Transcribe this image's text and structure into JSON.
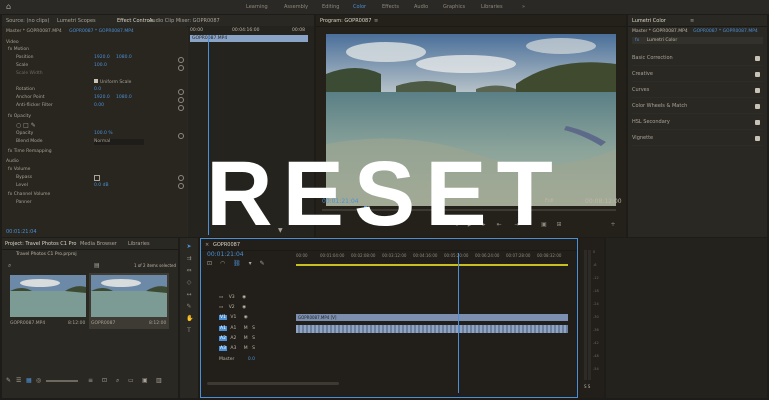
{
  "workspaces": [
    "Learning",
    "Assembly",
    "Editing",
    "Color",
    "Effects",
    "Audio",
    "Graphics",
    "Libraries"
  ],
  "active_workspace": "Color",
  "left_top_tabs": [
    "Source: (no clips)",
    "Lumetri Scopes",
    "Effect Controls",
    "Audio Clip Mixer: GOPR0087"
  ],
  "effect_controls": {
    "source": "Master * GOPR0087.MP4",
    "sequence": "GOPR0087 * GOPR0087.MP4",
    "header": "Video",
    "motion": "Motion",
    "position_label": "Position",
    "position_x": "1920.0",
    "position_y": "1080.0",
    "scale_label": "Scale",
    "scale_val": "100.0",
    "scale_width_label": "Scale Width",
    "uniform_scale": "Uniform Scale",
    "rotation_label": "Rotation",
    "rotation_val": "0.0",
    "anchor_label": "Anchor Point",
    "anchor_x": "1920.0",
    "anchor_y": "1080.0",
    "antiflicker_label": "Anti-flicker Filter",
    "antiflicker_val": "0.00",
    "opacity_section": "Opacity",
    "opacity_label": "Opacity",
    "opacity_val": "100.0 %",
    "blend_label": "Blend Mode",
    "blend_val": "Normal",
    "time_remap": "Time Remapping",
    "audio_header": "Audio",
    "volume": "Volume",
    "bypass_label": "Bypass",
    "level_label": "Level",
    "level_val": "0.0 dB",
    "channel_volume": "Channel Volume",
    "panner": "Panner",
    "clip_name": "GOPR0087.MP4",
    "timecode_top1": "00:00",
    "timecode_top2": "00:04:16:00",
    "timecode_top3": "00:08",
    "timecode_bottom": "00:01:21:04"
  },
  "program": {
    "title": "Program: GOPR0087",
    "timecode": "00:01:21:04",
    "fit": "Full",
    "duration": "00:08:12:00"
  },
  "lumetri": {
    "title": "Lumetri Color",
    "source": "Master * GOPR0087.MP4",
    "sequence": "GOPR0087 * GOPR0087.MP4",
    "fx": "fx",
    "effect_name": "Lumetri Color",
    "sections": [
      "Basic Correction",
      "Creative",
      "Curves",
      "Color Wheels & Match",
      "HSL Secondary",
      "Vignette"
    ]
  },
  "project": {
    "tabs": [
      "Project: Travel Photos C1 Pro",
      "Media Browser",
      "Libraries"
    ],
    "file": "Travel Photos C1 Pro.prproj",
    "selection": "1 of 2 items selected",
    "items": [
      {
        "name": "GOPR0087.MP4",
        "duration": "8:12:00"
      },
      {
        "name": "GOPR0087",
        "duration": "8:12:00"
      }
    ]
  },
  "timeline": {
    "close": "×",
    "sequence_name": "GOPR0087",
    "timecode": "00:01:21:04",
    "ruler": [
      "00:00",
      "00:01:04:00",
      "00:02:08:00",
      "00:03:12:00",
      "00:04:16:00",
      "00:05:20:00",
      "00:06:24:00",
      "00:07:28:00",
      "00:08:32:00"
    ],
    "tracks_v": [
      "V3",
      "V2",
      "V1"
    ],
    "tracks_a": [
      "A1",
      "A2",
      "A3"
    ],
    "master_label": "Master",
    "master_val": "0.0",
    "clip_v": "GOPR0087.MP4 [V]",
    "meter_labels": [
      "0",
      "-6",
      "-12",
      "-18",
      "-24",
      "-30",
      "-36",
      "-42",
      "-48",
      "-54"
    ],
    "meter_footer": "S S"
  },
  "overlay_title": "RESET",
  "colors": {
    "accent": "#4b90d6",
    "playhead": "#4b90d6",
    "work_area": "#c8c020",
    "clip_video": "#7c8fb0"
  }
}
